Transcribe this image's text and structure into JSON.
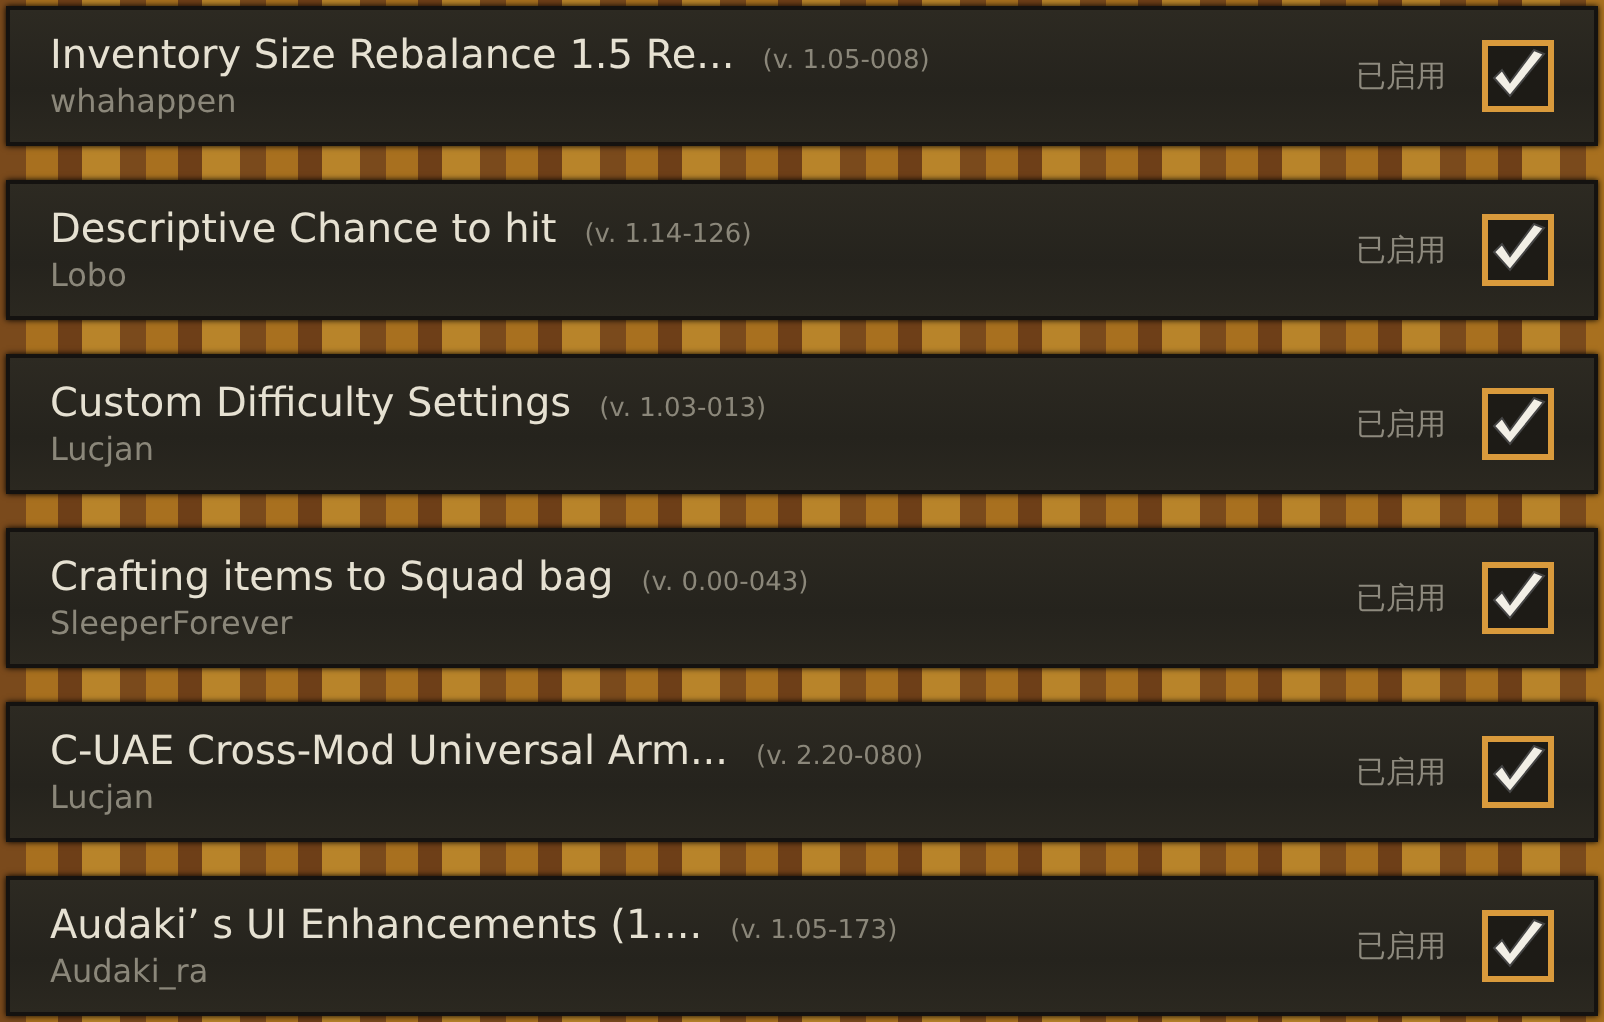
{
  "mods": [
    {
      "title": "Inventory Size Rebalance 1.5 Re...",
      "version": "(v. 1.05-008)",
      "author": "whahappen",
      "status": "已启用",
      "checked": true
    },
    {
      "title": "Descriptive Chance to hit",
      "version": "(v. 1.14-126)",
      "author": "Lobo",
      "status": "已启用",
      "checked": true
    },
    {
      "title": "Custom Difficulty Settings",
      "version": "(v. 1.03-013)",
      "author": "Lucjan",
      "status": "已启用",
      "checked": true
    },
    {
      "title": "Crafting items to Squad bag",
      "version": "(v. 0.00-043)",
      "author": "SleeperForever",
      "status": "已启用",
      "checked": true
    },
    {
      "title": "C-UAE Cross-Mod Universal Arm...",
      "version": "(v. 2.20-080)",
      "author": "Lucjan",
      "status": "已启用",
      "checked": true
    },
    {
      "title": "Audaki’ s UI Enhancements (1....",
      "version": "(v. 1.05-173)",
      "author": "Audaki_ra",
      "status": "已启用",
      "checked": true
    }
  ]
}
